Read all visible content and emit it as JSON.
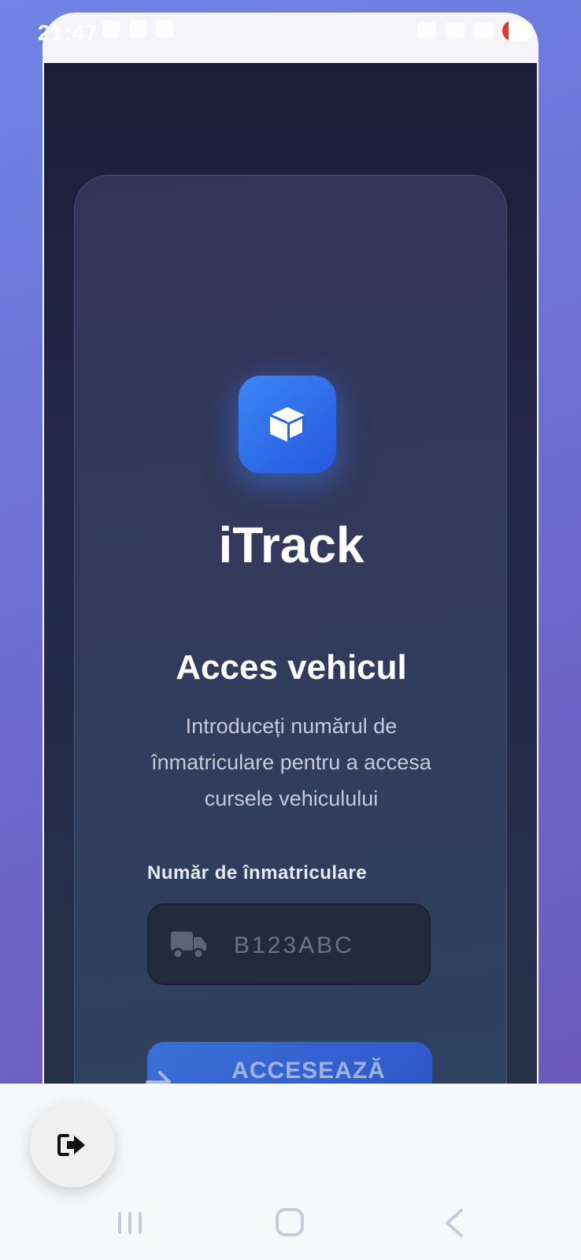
{
  "status_bar": {
    "time": "21:47"
  },
  "app": {
    "name": "iTrack",
    "heading": "Acces vehicul",
    "subtext": "Introduceți numărul de înmatriculare pentru a accesa cursele vehiculului",
    "plate_field": {
      "label": "Număr de înmatriculare",
      "placeholder": "B123ABC",
      "value": ""
    },
    "access_button_label": "ACCESEAZĂ CURSELE"
  },
  "colors": {
    "accent": "#3b82f6",
    "card_background": "#333a5c",
    "screen_background": "#1b1d38"
  },
  "icons": {
    "logo": "cube-icon",
    "plate_field": "truck-icon",
    "access_button": "arrow-right-icon",
    "fab": "logout-icon"
  }
}
